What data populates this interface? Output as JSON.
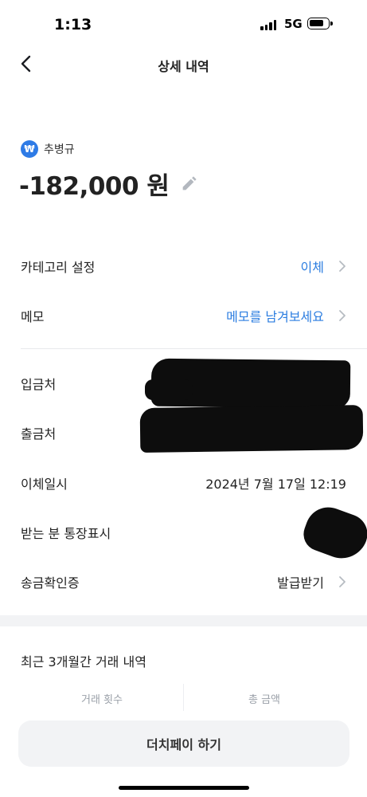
{
  "status_bar": {
    "time": "1:13",
    "network": "5G",
    "icons": [
      "signal-icon",
      "battery-icon"
    ]
  },
  "header": {
    "title": "상세 내역",
    "back_icon": "chevron-left-icon"
  },
  "transaction": {
    "bank_icon": "won-icon",
    "bank_icon_glyph": "₩",
    "account_name": "추병규",
    "amount": "-182,000 원",
    "edit_icon": "pencil-icon"
  },
  "details": {
    "category": {
      "label": "카테고리 설정",
      "value": "이체"
    },
    "memo": {
      "label": "메모",
      "value": "메모를 남겨보세요"
    },
    "deposit_to": {
      "label": "입금처",
      "value": ""
    },
    "withdraw_from": {
      "label": "출금처",
      "value": ""
    },
    "transfer_datetime": {
      "label": "이체일시",
      "value": "2024년 7월 17일 12:19"
    },
    "recipient_display": {
      "label": "받는 분 통장표시",
      "value": ""
    },
    "receipt": {
      "label": "송금확인증",
      "value": "발급받기"
    }
  },
  "recent": {
    "title": "최근 3개월간 거래 내역",
    "count_label": "거래 횟수",
    "total_label": "총 금액"
  },
  "cta": {
    "label": "더치페이 하기"
  },
  "colors": {
    "accent": "#2b7de0",
    "bank_icon": "#2e7be6",
    "text": "#222222",
    "muted": "#9aa0a8",
    "surface": "#f2f3f5"
  }
}
